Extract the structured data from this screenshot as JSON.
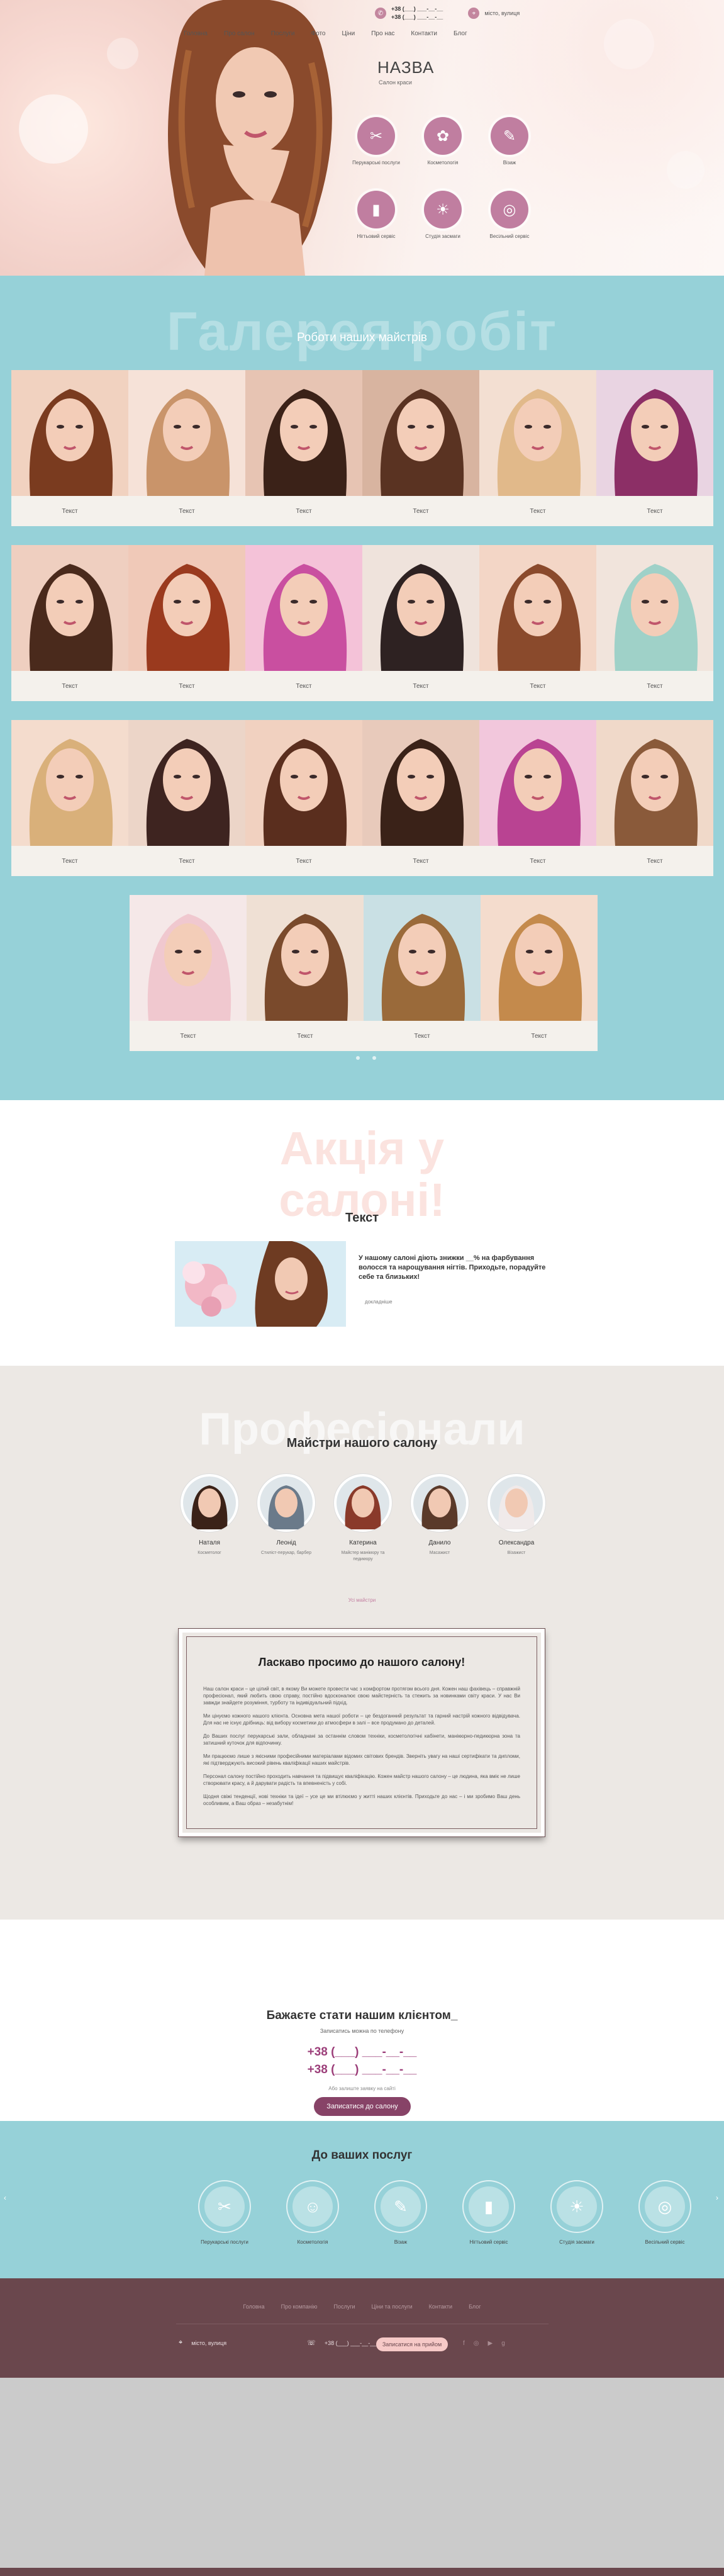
{
  "header": {
    "phones": [
      "+38 (___) ___-__-__",
      "+38 (___) ___-__-__"
    ],
    "address": "місто, вулиця",
    "nav": [
      "Головна",
      "Про салон",
      "Послуги",
      "Фото",
      "Ціни",
      "Про нас",
      "Контакти",
      "Блог"
    ],
    "title": "НАЗВА",
    "subtitle": "Салон краси",
    "services": [
      {
        "label": "Перукарські послуги",
        "icon": "scissors-icon",
        "glyph": "✂"
      },
      {
        "label": "Косметологія",
        "icon": "cosmetology-icon",
        "glyph": "✿"
      },
      {
        "label": "Візаж",
        "icon": "makeup-brush-icon",
        "glyph": "✎"
      },
      {
        "label": "Нігтьовий сервіс",
        "icon": "nail-polish-icon",
        "glyph": "▮"
      },
      {
        "label": "Студія засмаги",
        "icon": "tanning-icon",
        "glyph": "☀"
      },
      {
        "label": "Весільний сервіс",
        "icon": "ring-icon",
        "glyph": "◎"
      }
    ]
  },
  "gallery": {
    "bg_title": "Галерея робіт",
    "title": "Роботи наших майстрів",
    "rows": [
      [
        "Текст",
        "Текст",
        "Текст",
        "Текст",
        "Текст",
        "Текст"
      ],
      [
        "Текст",
        "Текст",
        "Текст",
        "Текст",
        "Текст",
        "Текст"
      ],
      [
        "Текст",
        "Текст",
        "Текст",
        "Текст",
        "Текст",
        "Текст"
      ],
      [
        "Текст",
        "Текст",
        "Текст",
        "Текст"
      ]
    ]
  },
  "promo": {
    "bg_title_1": "Акція у",
    "bg_title_2": "салоні!",
    "title": "Текст",
    "text": "У нашому салоні діють знижки __% на фарбування волосся та нарощування нігтів. Приходьте, порадуйте себе та близьких!",
    "more": "докладніше"
  },
  "masters": {
    "bg_title": "Професіонали",
    "title": "Майстри нашого салону",
    "list": [
      {
        "name": "Наталя",
        "role": "Косметолог"
      },
      {
        "name": "Леонід",
        "role": "Стиліст-перукар, барбер"
      },
      {
        "name": "Катерина",
        "role": "Майстер манікюру та педикюру"
      },
      {
        "name": "Данило",
        "role": "Масажист"
      },
      {
        "name": "Олександра",
        "role": "Візажист"
      }
    ],
    "all_link": "Усі майстри"
  },
  "welcome": {
    "title": "Ласкаво просимо до нашого салону!",
    "paragraphs": [
      "Наш салон краси – це цілий світ, в якому Ви можете провести час з комфортом протягом всього дня. Кожен наш фахівець – справжній професіонал, який любить свою справу, постійно вдосконалює свою майстерність та стежить за новинками світу краси. У нас Ви завжди знайдете розуміння, турботу та індивідуальний підхід.",
      "Ми цінуємо кожного нашого клієнта. Основна мета нашої роботи – це бездоганний результат та гарний настрій кожного відвідувача. Для нас не існує дрібниць: від вибору косметики до атмосфери в залі – все продумано до деталей.",
      "До Ваших послуг перукарські зали, обладнані за останнім словом техніки, косметологічні кабінети, манікюрно-педикюрна зона та затишний куточок для відпочинку.",
      "Ми працюємо лише з якісними професійними матеріалами відомих світових брендів. Зверніть увагу на наші сертифікати та дипломи, які підтверджують високий рівень кваліфікації наших майстрів.",
      "Персонал салону постійно проходить навчання та підвищує кваліфікацію. Кожен майстр нашого салону – це людина, яка вміє не лише створювати красу, а й дарувати радість та впевненість у собі.",
      "Щодня свіжі тенденції, нові техніки та ідеї – усе це ми втілюємо у житті наших клієнтів. Приходьте до нас – і ми зробимо Ваш день особливим, а Ваш образ – незабутнім!"
    ]
  },
  "booking": {
    "title": "Бажаєте стати нашим клієнтом_",
    "subtitle": "Записатись можна по телефону",
    "phone1": "+38 (___) ___-__-__",
    "phone2": "+38 (___) ___-__-__",
    "note": "Або залиште заявку на сайті",
    "button": "Записатися до салону"
  },
  "services": {
    "title": "До ваших послуг",
    "items": [
      {
        "label": "Перукарські послуги",
        "icon": "scissors-icon",
        "glyph": "✂"
      },
      {
        "label": "Косметологія",
        "icon": "face-icon",
        "glyph": "☺"
      },
      {
        "label": "Візаж",
        "icon": "makeup-brush-icon",
        "glyph": "✎"
      },
      {
        "label": "Нігтьовий сервіс",
        "icon": "nail-polish-icon",
        "glyph": "▮"
      },
      {
        "label": "Студія засмаги",
        "icon": "tanning-icon",
        "glyph": "☀"
      },
      {
        "label": "Весільний сервіс",
        "icon": "ring-icon",
        "glyph": "◎"
      }
    ]
  },
  "footer": {
    "nav": [
      "Головна",
      "Про компанію",
      "Послуги",
      "Ціни та послуги",
      "Контакти",
      "Блог"
    ],
    "address": "місто, вулиця",
    "phone": "+38 (___) ___-__-__",
    "button": "Записатися на прийом"
  },
  "colors": {
    "accent": "#874367",
    "teal": "#96d1d8",
    "footer": "#6a474d",
    "icon_bg": "#c07ea0"
  }
}
